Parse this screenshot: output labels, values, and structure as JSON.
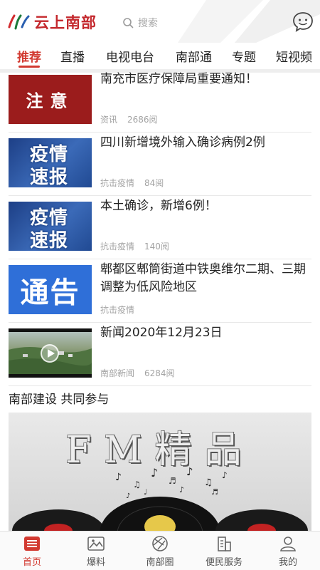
{
  "header": {
    "logo_text": "云上南部",
    "search_placeholder": "搜索",
    "icons": [
      "logo-mark-icon",
      "search-icon",
      "chat-bubble-icon"
    ]
  },
  "tabs": [
    {
      "label": "推荐",
      "active": true
    },
    {
      "label": "直播"
    },
    {
      "label": "电视电台"
    },
    {
      "label": "南部通"
    },
    {
      "label": "专题"
    },
    {
      "label": "短视频"
    }
  ],
  "news": [
    {
      "thumb_text": "注意",
      "title": "南充市医疗保障局重要通知！",
      "category": "资讯",
      "views": "2686阅"
    },
    {
      "thumb_text_1": "疫情",
      "thumb_text_2": "速报",
      "title": "四川新增境外输入确诊病例2例",
      "category": "抗击疫情",
      "views": "84阅"
    },
    {
      "thumb_text_1": "疫情",
      "thumb_text_2": "速报",
      "title": "本土确诊，新增6例！",
      "category": "抗击疫情",
      "views": "140阅"
    },
    {
      "thumb_text": "通告",
      "title": "郫都区郫筒街道中铁奥维尔二期、三期调整为低风险地区",
      "category": "抗击疫情",
      "views": ""
    },
    {
      "title": "新闻2020年12月23日",
      "category": "南部新闻",
      "views": "6284阅"
    }
  ],
  "section": {
    "title": "南部建设 共同参与",
    "banner_text": "FM精品"
  },
  "bottom_nav": [
    {
      "label": "首页",
      "icon": "home-list-icon",
      "active": true
    },
    {
      "label": "爆料",
      "icon": "image-icon"
    },
    {
      "label": "南部圈",
      "icon": "aperture-icon"
    },
    {
      "label": "便民服务",
      "icon": "building-icon"
    },
    {
      "label": "我的",
      "icon": "user-icon"
    }
  ],
  "colors": {
    "accent": "#d23a31",
    "logo": "#c4282d"
  }
}
